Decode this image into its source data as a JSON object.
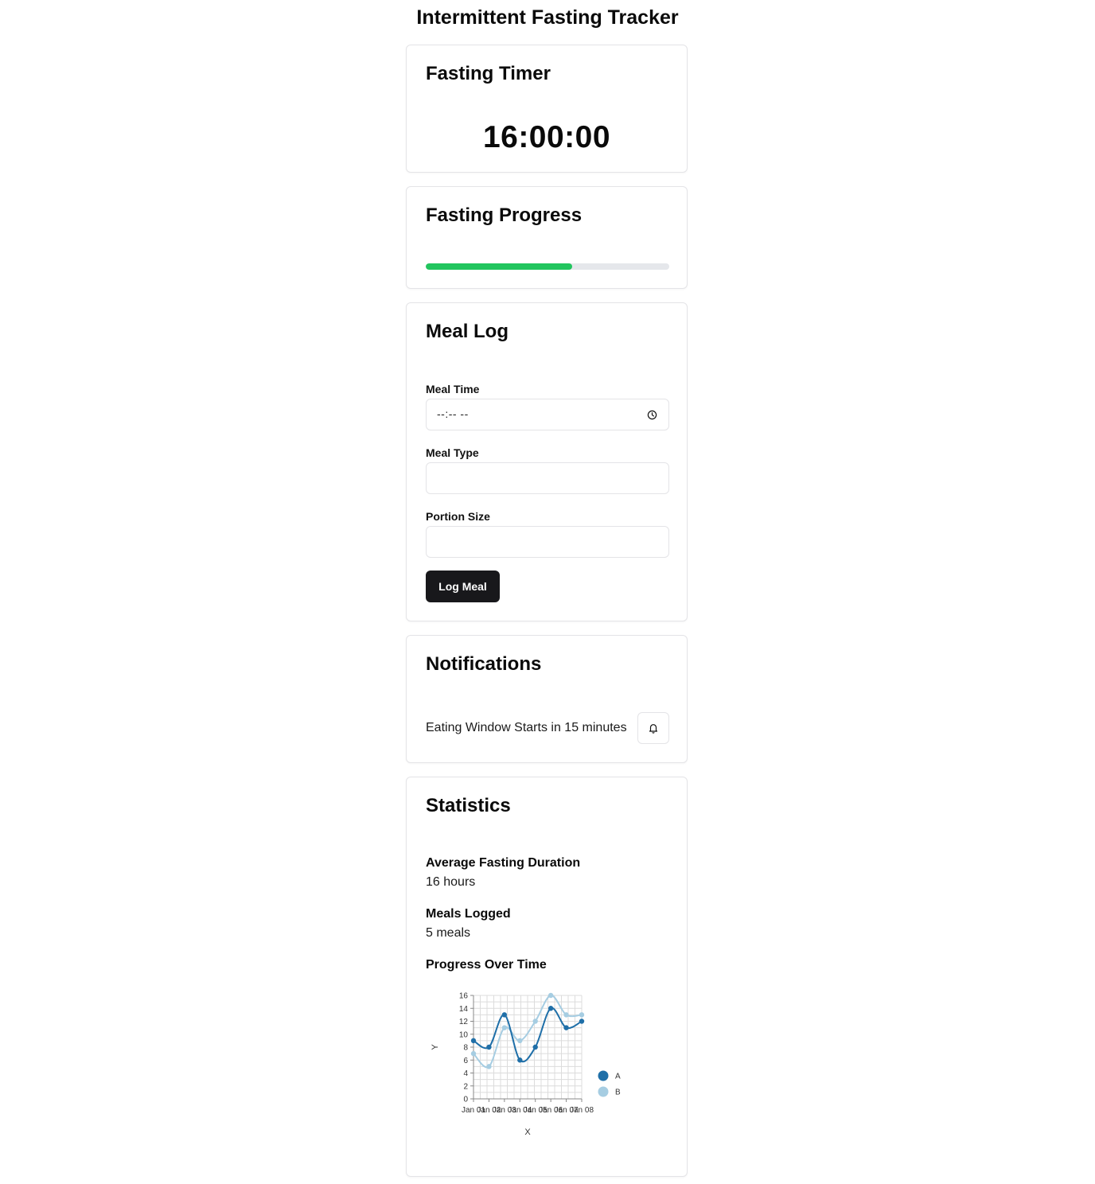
{
  "app": {
    "title": "Intermittent Fasting Tracker"
  },
  "timer": {
    "title": "Fasting Timer",
    "value": "16:00:00"
  },
  "progress": {
    "title": "Fasting Progress",
    "percent": 60,
    "fill_color": "#22c55e"
  },
  "meal_log": {
    "title": "Meal Log",
    "meal_time": {
      "label": "Meal Time",
      "placeholder": "--:-- --"
    },
    "meal_type": {
      "label": "Meal Type",
      "value": ""
    },
    "portion_size": {
      "label": "Portion Size",
      "value": ""
    },
    "submit_label": "Log Meal",
    "icons": {
      "time": "clock-icon"
    }
  },
  "notifications": {
    "title": "Notifications",
    "message": "Eating Window Starts in 15 minutes",
    "icon": "bell-icon"
  },
  "statistics": {
    "title": "Statistics",
    "avg_label": "Average Fasting Duration",
    "avg_value": "16 hours",
    "meals_label": "Meals Logged",
    "meals_value": "5 meals",
    "chart_title": "Progress Over Time"
  },
  "chart_data": {
    "type": "line",
    "xlabel": "X",
    "ylabel": "Y",
    "categories": [
      "Jan 01",
      "Jan 02",
      "Jan 03",
      "Jan 04",
      "Jan 05",
      "Jan 06",
      "Jan 07",
      "Jan 08"
    ],
    "ylim": [
      0,
      16
    ],
    "yticks": [
      0,
      2,
      4,
      6,
      8,
      10,
      12,
      14,
      16
    ],
    "grid": true,
    "legend": "right",
    "series": [
      {
        "name": "A",
        "color": "#1f6fa8",
        "values": [
          9,
          8,
          13,
          6,
          8,
          14,
          11,
          12
        ]
      },
      {
        "name": "B",
        "color": "#a6cde2",
        "values": [
          7,
          5,
          11,
          9,
          12,
          16,
          13,
          13
        ]
      }
    ]
  }
}
